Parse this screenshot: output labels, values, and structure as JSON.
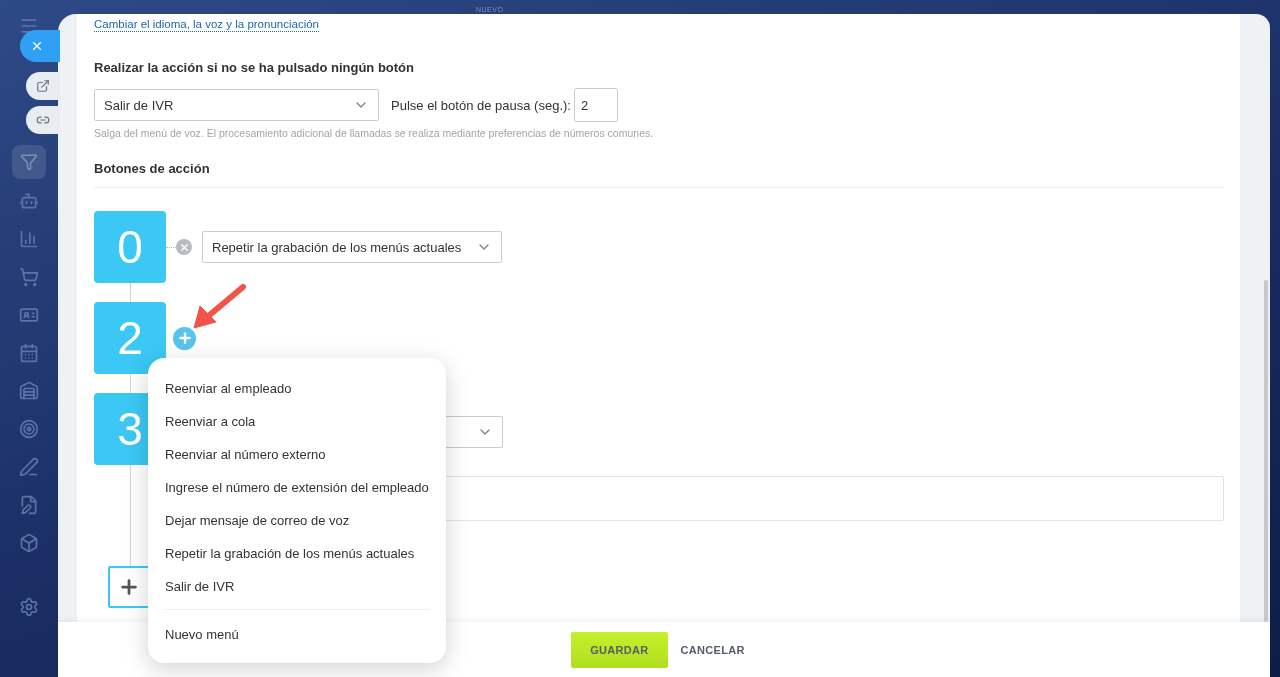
{
  "background": {
    "label": "NUEVO"
  },
  "panel": {
    "link": "Cambiar el idioma, la voz y la pronunciación",
    "no_press": {
      "heading": "Realizar la acción si no se ha pulsado ningún botón",
      "action_select": {
        "value": "Salir de IVR"
      },
      "pause_label": "Pulse el botón de pausa (seg.):",
      "pause_value": "2",
      "hint": "Salga del menú de voz. El procesamiento adicional de llamadas se realiza mediante preferencias de números comunes."
    },
    "action_buttons": {
      "heading": "Botones de acción",
      "nodes": [
        {
          "digit": "0",
          "kind": "remove",
          "action": "Repetir la grabación de los menús actuales"
        },
        {
          "digit": "2",
          "kind": "add"
        },
        {
          "digit": "3",
          "kind": "field"
        }
      ]
    }
  },
  "dropdown_menu": {
    "items": [
      {
        "label": "Reenviar al empleado",
        "kind": "action"
      },
      {
        "label": "Reenviar a cola",
        "kind": "action"
      },
      {
        "label": "Reenviar al número externo",
        "kind": "action"
      },
      {
        "label": "Ingrese el número de extensión del empleado",
        "kind": "action"
      },
      {
        "label": "Dejar mensaje de correo de voz",
        "kind": "action"
      },
      {
        "label": "Repetir la grabación de los menús actuales",
        "kind": "action"
      },
      {
        "label": "Salir de IVR",
        "kind": "action"
      },
      {
        "label": "Nuevo menú",
        "kind": "menu"
      }
    ]
  },
  "footer": {
    "buttons": [
      {
        "label": "GUARDAR",
        "kind": "primary"
      },
      {
        "label": "CANCELAR",
        "kind": "link"
      }
    ]
  }
}
